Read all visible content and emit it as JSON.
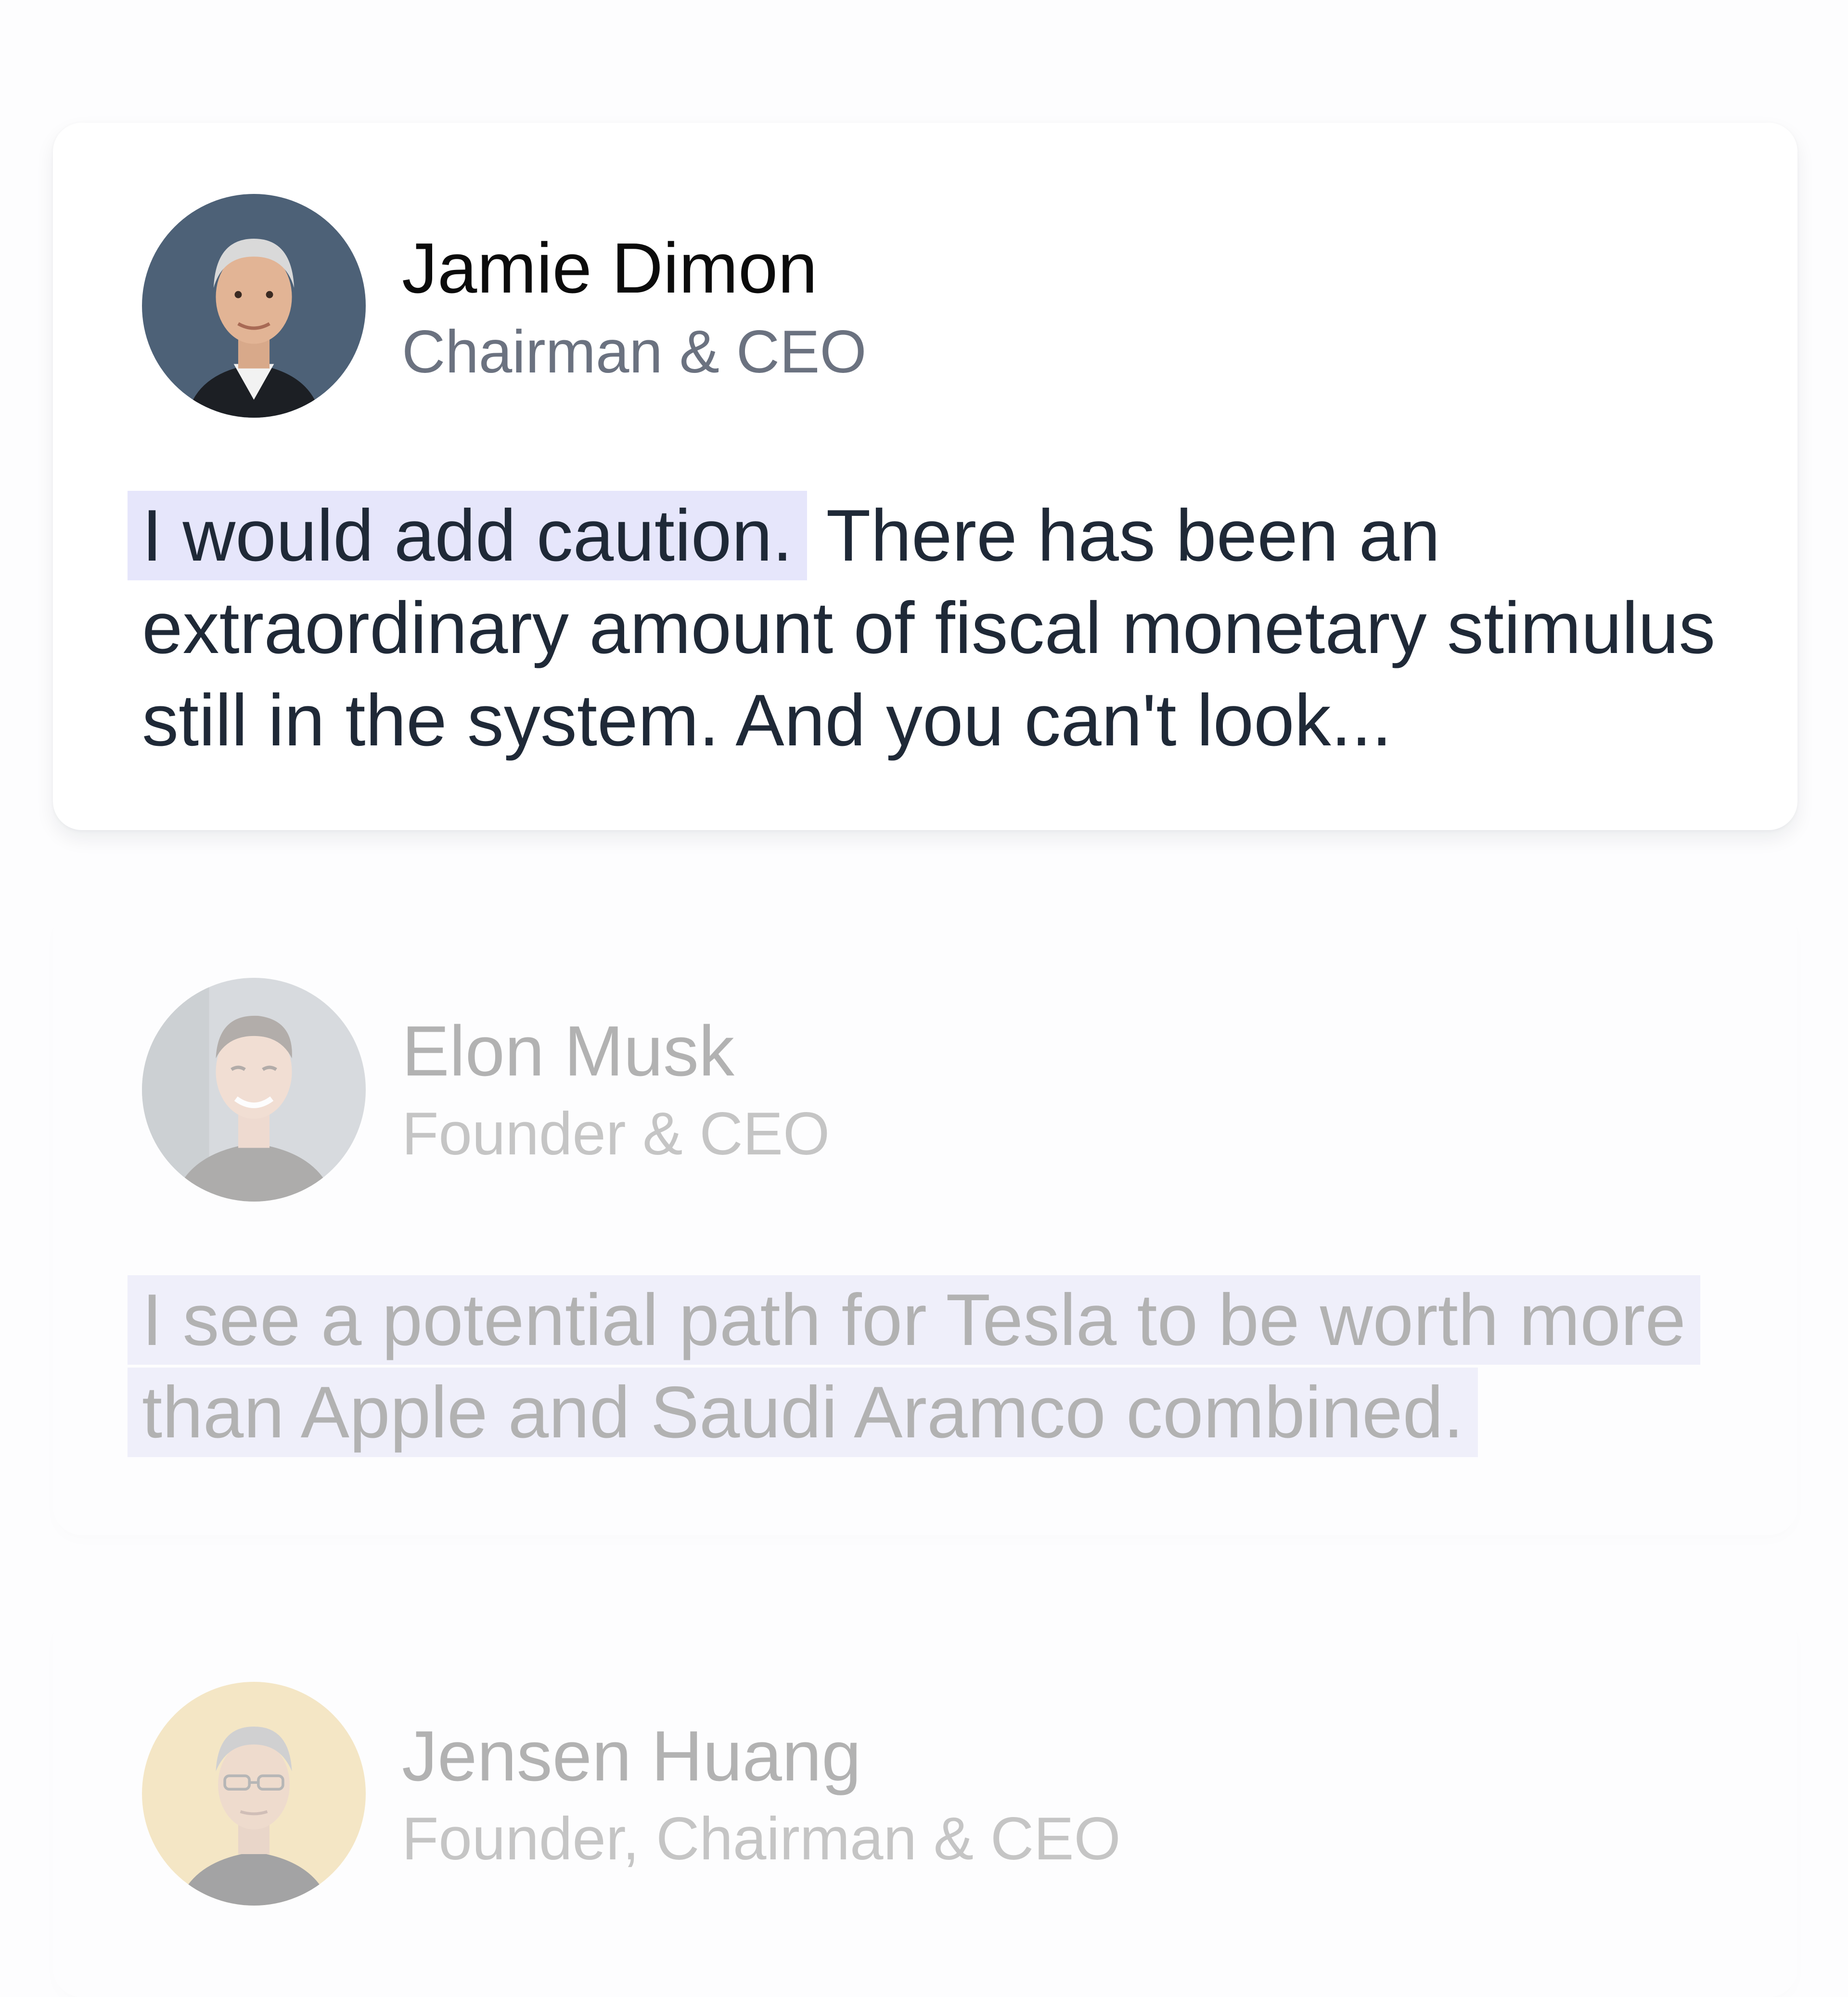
{
  "cards": [
    {
      "name": "Jamie Dimon",
      "role": "Chairman & CEO",
      "quote_highlight": "I would add caution.",
      "quote_rest": " There has been an extraordinary amount of fiscal monetary stimulus still in the system. And you can't look...",
      "avatar_icon": "jamie-dimon-photo",
      "state": "active"
    },
    {
      "name": "Elon Musk",
      "role": "Founder & CEO",
      "quote_highlight": "I see a potential path for Tesla to be worth more than Apple and Saudi Aramco combined.",
      "quote_rest": "",
      "avatar_icon": "elon-musk-photo",
      "state": "inactive"
    },
    {
      "name": "Jensen Huang",
      "role": "Founder, Chairman & CEO",
      "quote_highlight": "",
      "quote_rest": "",
      "avatar_icon": "jensen-huang-photo",
      "state": "inactive"
    }
  ],
  "colors": {
    "highlight": "#e6e6fb",
    "name": "#0b0b0b",
    "role": "#6b7280",
    "quote": "#1f2937",
    "background": "#fdfdfe"
  }
}
